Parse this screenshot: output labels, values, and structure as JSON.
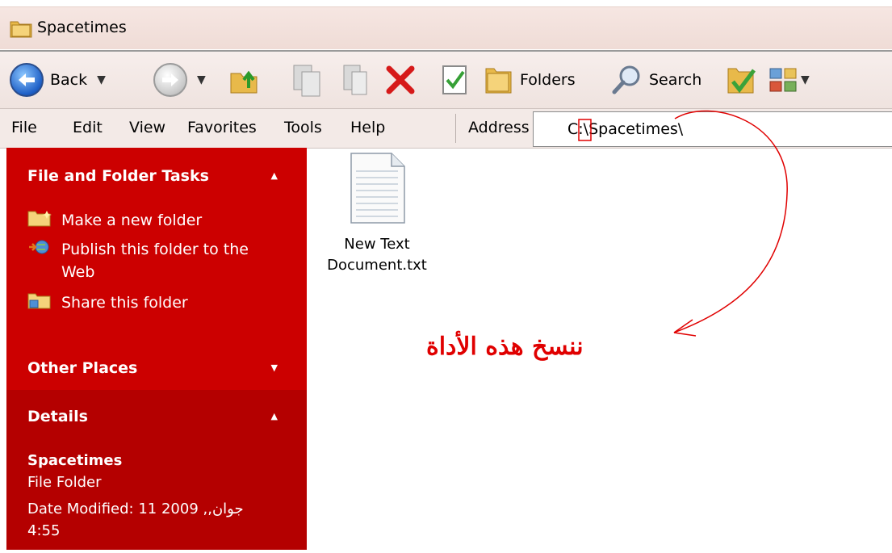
{
  "window": {
    "title": "Spacetimes"
  },
  "toolbar": {
    "back_label": "Back",
    "folders_label": "Folders",
    "search_label": "Search"
  },
  "menu": {
    "items": [
      "File",
      "Edit",
      "View",
      "Favorites",
      "Tools",
      "Help"
    ]
  },
  "address": {
    "label": "Address",
    "value": "C:\\Spacetimes\\"
  },
  "taskpane": {
    "file_folder_tasks": {
      "title": "File and Folder Tasks",
      "items": [
        {
          "label": "Make a new folder",
          "icon": "new-folder-icon"
        },
        {
          "label": "Publish this folder to the Web",
          "icon": "publish-web-icon"
        },
        {
          "label": "Share this folder",
          "icon": "share-folder-icon"
        }
      ]
    },
    "other_places": {
      "title": "Other Places"
    },
    "details": {
      "title": "Details",
      "name": "Spacetimes",
      "type": "File Folder",
      "date_modified": "Date Modified: 11 2009 ,جوان, 4:55"
    }
  },
  "content": {
    "files": [
      {
        "name": "New Text Document.txt",
        "icon": "text-file-icon"
      }
    ]
  },
  "annotation": {
    "text": "ننسخ هذه الأداة"
  },
  "colors": {
    "pane_red": "#cc0000",
    "details_red": "#b40000",
    "annotation_red": "#e00000"
  }
}
